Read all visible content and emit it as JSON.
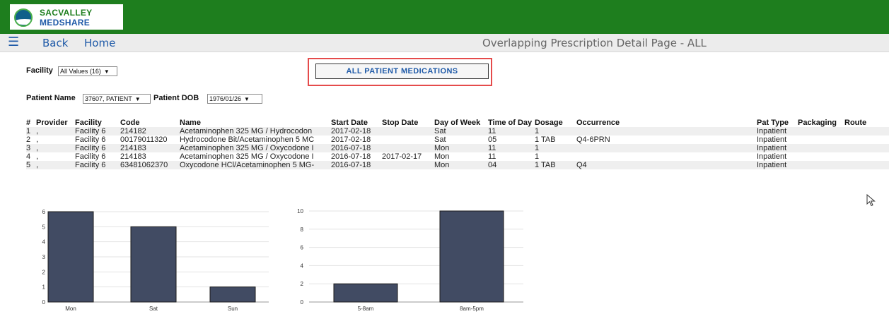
{
  "app": {
    "logo_line1": "SACVALLEY",
    "logo_line2": "MEDSHARE",
    "brand_color": "#1e7e1e"
  },
  "nav": {
    "menu_icon": "hamburger-menu-icon",
    "back_label": "Back",
    "home_label": "Home",
    "page_title": "Overlapping Prescription Detail Page - ALL"
  },
  "filters": {
    "facility_label": "Facility",
    "facility_value": "All Values (16)",
    "patient_name_label": "Patient Name",
    "patient_name_value": "37607, PATIENT",
    "patient_dob_label": "Patient DOB",
    "patient_dob_value": "1976/01/26"
  },
  "actions": {
    "all_meds_label": "ALL PATIENT MEDICATIONS",
    "highlight_color": "#e54b4b"
  },
  "table": {
    "headers": [
      "#",
      "Provider",
      "Facility",
      "Code",
      "Name",
      "Start Date",
      "Stop Date",
      "Day of Week",
      "Time of Day",
      "Dosage",
      "Occurrence",
      "Pat Type",
      "Packaging",
      "Route"
    ],
    "rows": [
      [
        "1",
        ",",
        "Facility 6",
        "214182",
        "Acetaminophen 325 MG / Hydrocodon",
        "2017-02-18",
        "",
        "Sat",
        "11",
        "1",
        "",
        "Inpatient",
        "",
        ""
      ],
      [
        "2",
        ",",
        "Facility 6",
        "00179011320",
        "Hydrocodone Bit/Acetaminophen 5 MC",
        "2017-02-18",
        "",
        "Sat",
        "05",
        "1 TAB",
        "Q4-6PRN",
        "Inpatient",
        "",
        ""
      ],
      [
        "3",
        ",",
        "Facility 6",
        "214183",
        "Acetaminophen 325 MG / Oxycodone I",
        "2016-07-18",
        "",
        "Mon",
        "11",
        "1",
        "",
        "Inpatient",
        "",
        ""
      ],
      [
        "4",
        ",",
        "Facility 6",
        "214183",
        "Acetaminophen 325 MG / Oxycodone I",
        "2016-07-18",
        "2017-02-17",
        "Mon",
        "11",
        "1",
        "",
        "Inpatient",
        "",
        ""
      ],
      [
        "5",
        ",",
        "Facility 6",
        "63481062370",
        "Oxycodone HCl/Acetaminophen 5 MG-",
        "2016-07-18",
        "",
        "Mon",
        "04",
        "1 TAB",
        "Q4",
        "Inpatient",
        "",
        ""
      ]
    ]
  },
  "chart_data": [
    {
      "type": "bar",
      "categories": [
        "Mon",
        "Sat",
        "Sun"
      ],
      "values": [
        6,
        5,
        1
      ],
      "ylim": [
        0,
        6
      ],
      "yticks": [
        0,
        1,
        2,
        3,
        4,
        5,
        6
      ],
      "grid": true,
      "bar_color": "#414b63"
    },
    {
      "type": "bar",
      "categories": [
        "5-8am",
        "8am-5pm"
      ],
      "values": [
        2,
        10
      ],
      "ylim": [
        0,
        10
      ],
      "yticks": [
        0,
        2,
        4,
        6,
        8,
        10
      ],
      "grid": true,
      "bar_color": "#414b63"
    }
  ]
}
